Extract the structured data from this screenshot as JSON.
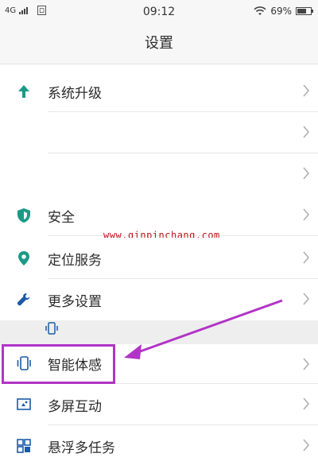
{
  "status_bar": {
    "network": "4G",
    "time": "09:12",
    "battery": "69%",
    "battery_level": 0.69
  },
  "header": {
    "title": "设置"
  },
  "items": [
    {
      "label": "系统升级",
      "icon": "arrow-up-icon"
    },
    {
      "label": "",
      "icon": ""
    },
    {
      "label": "",
      "icon": ""
    },
    {
      "label": "安全",
      "icon": "shield-icon"
    },
    {
      "label": "定位服务",
      "icon": "location-pin-icon"
    },
    {
      "label": "更多设置",
      "icon": "wrench-icon"
    },
    {
      "label": "智能体感",
      "icon": "phone-motion-icon"
    },
    {
      "label": "多屏互动",
      "icon": "multi-screen-icon"
    },
    {
      "label": "悬浮多任务",
      "icon": "floating-tasks-icon"
    }
  ],
  "watermark": "www.qinpinchang.com",
  "colors": {
    "accent": "#1a9a86",
    "highlight": "#b134c6",
    "watermark": "#c0151b"
  }
}
